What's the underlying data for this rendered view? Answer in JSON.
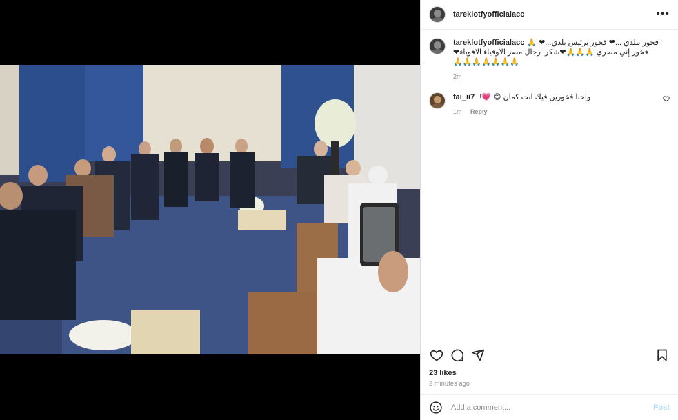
{
  "post": {
    "username": "tareklotfyofficialacc",
    "more_label": "•••",
    "caption": {
      "username": "tareklotfyofficialacc",
      "lines": [
        "فخور ببلدي ...❤ فخور برئيس بلدي...❤ 🙏",
        "فخور إني مصري 🙏🙏🙏❤شكرا رجال مصر الاوفياء الاقوياء❤",
        "🙏🙏🙏🙏🙏🙏🙏"
      ],
      "time": "2m"
    },
    "comments": [
      {
        "username": "fai_ii7",
        "text": "واحنا فخورين فيك انت كمان 😊 💗!",
        "time": "1m",
        "reply_label": "Reply"
      }
    ],
    "likes": "23 likes",
    "posted": "2 minutes ago",
    "add_comment_placeholder": "Add a comment...",
    "post_button": "Post"
  },
  "icons": {
    "like": "heart-icon",
    "comment": "comment-bubble-icon",
    "share": "paper-plane-icon",
    "save": "bookmark-icon",
    "emoji": "smiley-icon",
    "more": "more-options-icon"
  },
  "colors": {
    "post_button_disabled": "#b2dffc",
    "meta_gray": "#8e8e8e",
    "text": "#262626"
  }
}
